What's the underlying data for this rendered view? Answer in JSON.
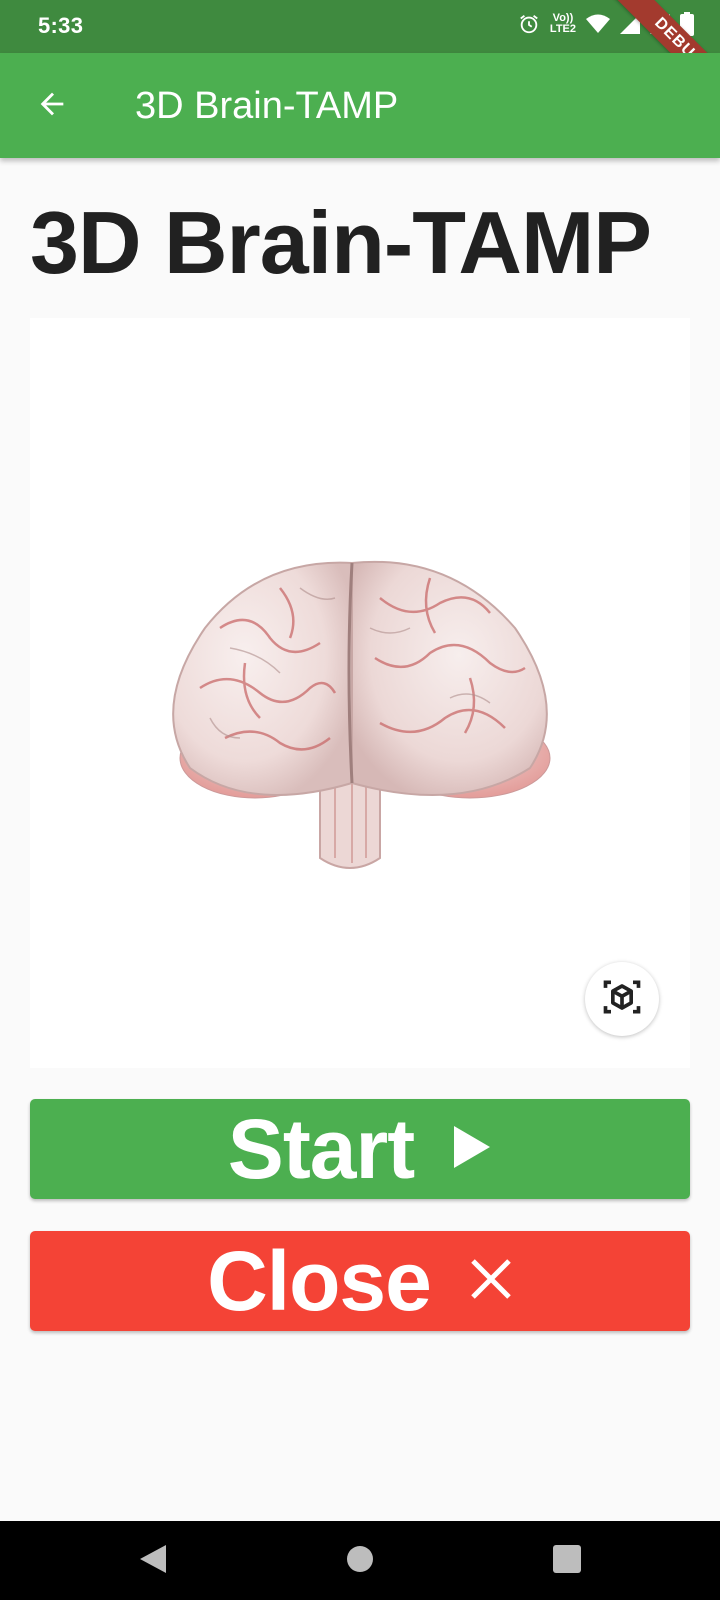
{
  "status_bar": {
    "time": "5:33",
    "volte_top": "Vo))",
    "volte_bottom": "LTE2",
    "icons": [
      "alarm-icon",
      "volte-icon",
      "wifi-icon",
      "signal-icon",
      "signal-icon",
      "battery-icon"
    ]
  },
  "debug_banner": "DEBUG",
  "app_bar": {
    "title": "3D Brain-TAMP",
    "back_icon": "arrow-back-icon"
  },
  "page": {
    "heading": "3D Brain-TAMP"
  },
  "viewer": {
    "ar_icon": "view-in-ar-icon"
  },
  "buttons": {
    "start_label": "Start",
    "start_icon": "play-icon",
    "close_label": "Close",
    "close_icon": "close-icon"
  },
  "nav_bar": {
    "icons": [
      "nav-back-icon",
      "nav-home-icon",
      "nav-recents-icon"
    ]
  },
  "colors": {
    "status_bar": "#3f8a3f",
    "app_bar": "#4caf50",
    "start_button": "#4caf50",
    "close_button": "#f44336",
    "debug_ribbon": "#a33a2e"
  }
}
